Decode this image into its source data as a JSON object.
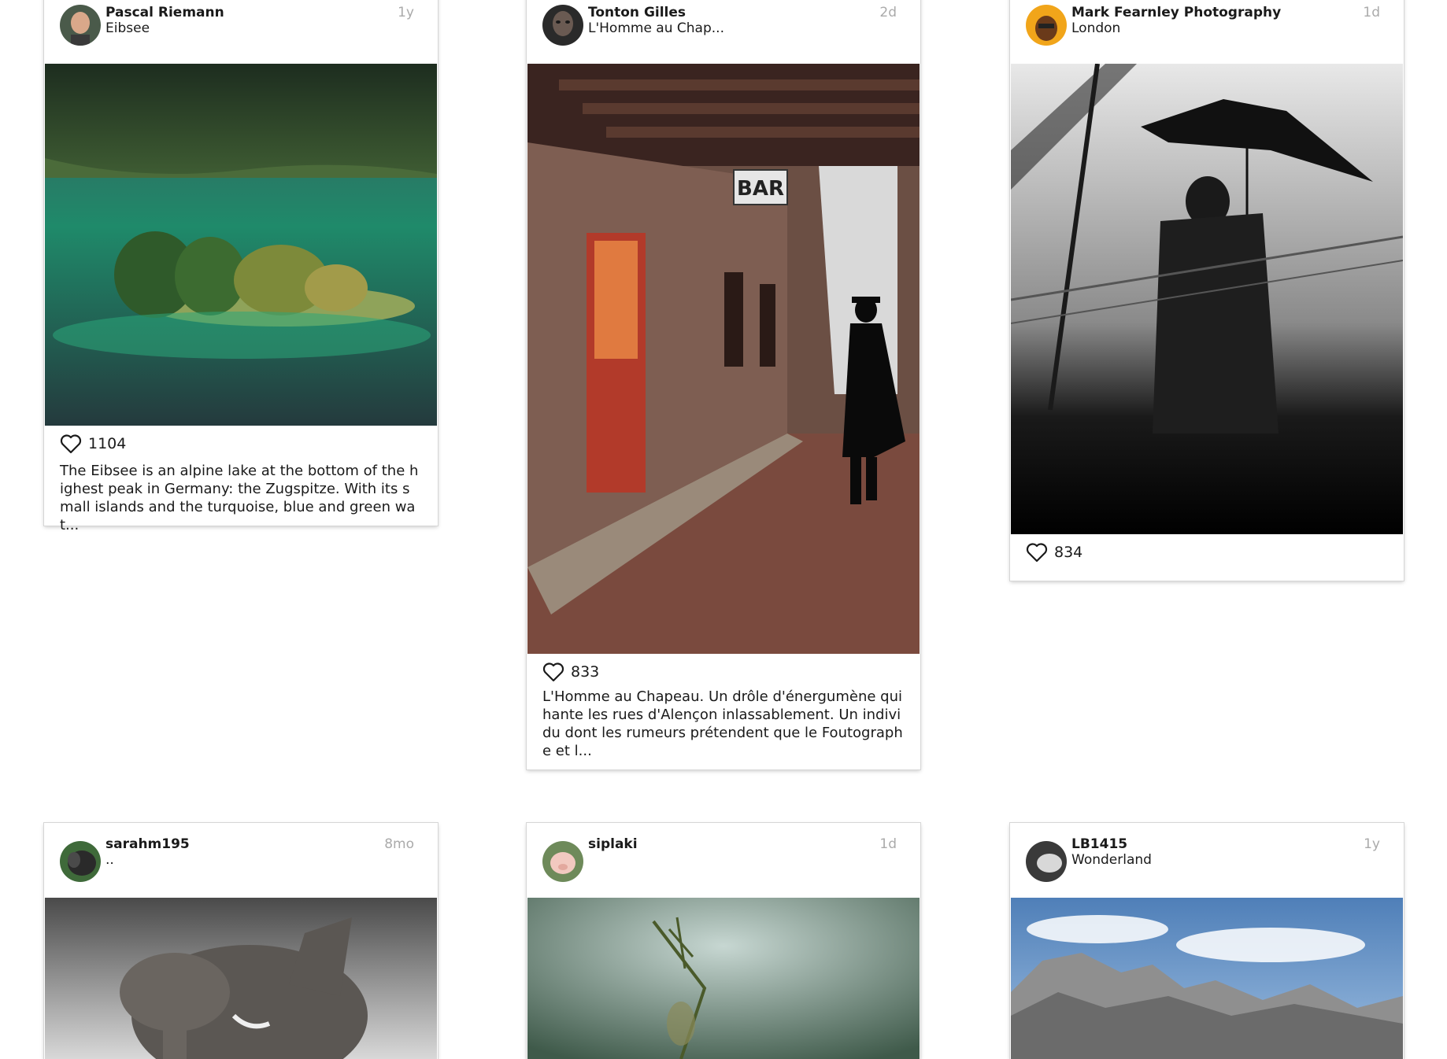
{
  "posts": [
    {
      "author": "Pascal Riemann",
      "location": "Eibsee",
      "age": "1y",
      "likes": "1104",
      "caption": "The Eibsee is an alpine lake at the bottom of the highest peak in Germany: the Zugspitze. With its small islands and the turquoise, blue and green wat...",
      "photo_subject": "alpine lake with forested island",
      "avatar_icon": "person-avatar-icon"
    },
    {
      "author": "Tonton Gilles",
      "location": "L'Homme au Chap...",
      "age": "2d",
      "likes": "833",
      "caption": "L'Homme au Chapeau. Un drôle d'énergumène qui hante les rues d'Alençon inlassablement. Un individu dont les rumeurs prétendent que le Foutographe et l...",
      "photo_sign": "BAR",
      "photo_subject": "man in hat walking down a narrow alley",
      "avatar_icon": "person-avatar-icon"
    },
    {
      "author": "Mark Fearnley Photography",
      "location": "London",
      "age": "1d",
      "likes": "834",
      "caption": "",
      "photo_subject": "silhouette with umbrella behind rainy glass",
      "avatar_icon": "person-avatar-icon"
    },
    {
      "author": "sarahm195",
      "location": "..",
      "age": "8mo",
      "photo_subject": "elephant",
      "avatar_icon": "animal-avatar-icon"
    },
    {
      "author": "siplaki",
      "location": "",
      "age": "1d",
      "photo_subject": "plant stem close-up",
      "avatar_icon": "pig-avatar-icon"
    },
    {
      "author": "LB1415",
      "location": "Wonderland",
      "age": "1y",
      "photo_subject": "mountain range under blue sky",
      "avatar_icon": "person-avatar-icon"
    }
  ],
  "colors": {
    "background": "#ffffff",
    "card_border": "#d6d6d6",
    "age_text": "#aaaaaa",
    "text": "#1a1a1a"
  },
  "icons": {
    "like": "heart-icon"
  }
}
